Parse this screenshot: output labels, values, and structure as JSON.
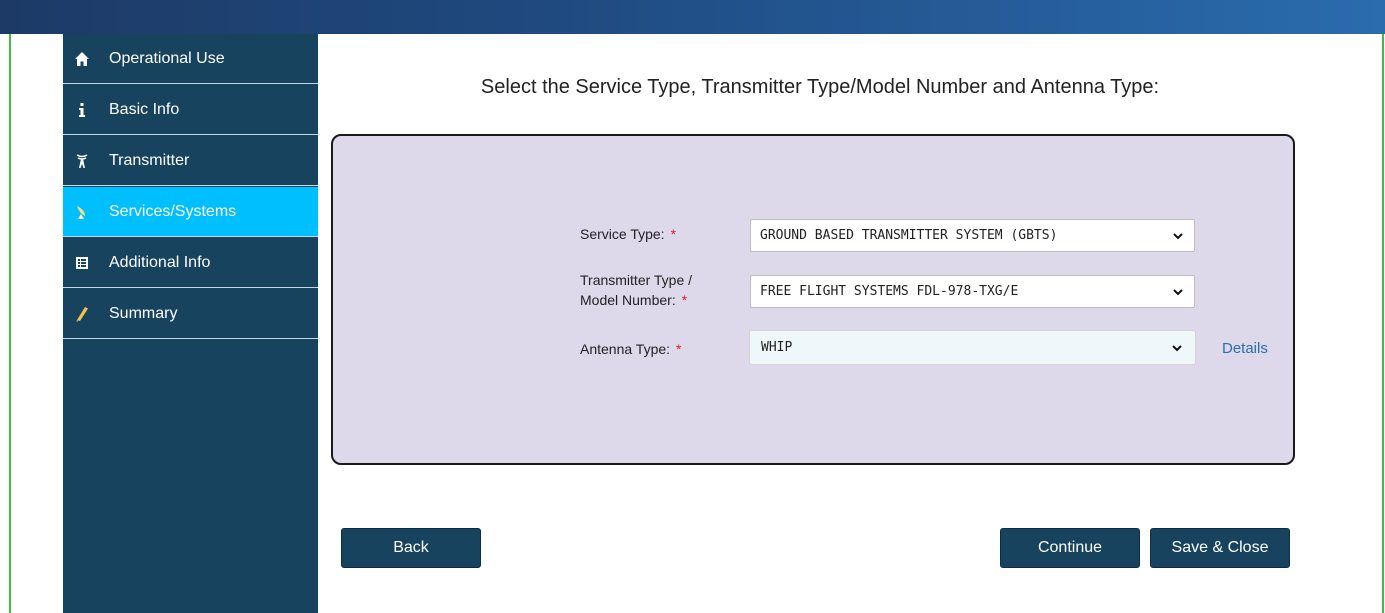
{
  "sidebar": {
    "items": [
      {
        "label": "Operational Use",
        "icon": "home-icon",
        "active": false
      },
      {
        "label": "Basic Info",
        "icon": "info-icon",
        "active": false
      },
      {
        "label": "Transmitter",
        "icon": "transmitter-tower-icon",
        "active": false
      },
      {
        "label": "Services/Systems",
        "icon": "satellite-dish-icon",
        "active": true
      },
      {
        "label": "Additional Info",
        "icon": "list-table-icon",
        "active": false
      },
      {
        "label": "Summary",
        "icon": "pencil-icon",
        "active": false
      }
    ]
  },
  "main": {
    "title": "Select the Service Type, Transmitter Type/Model Number and Antenna Type:",
    "fields": {
      "service_type": {
        "label": "Service Type:",
        "required": "*",
        "value": "GROUND BASED TRANSMITTER SYSTEM (GBTS)"
      },
      "transmitter_type": {
        "label_line1": "Transmitter Type /",
        "label_line2": "Model Number:",
        "required": "*",
        "value": "FREE FLIGHT SYSTEMS FDL-978-TXG/E"
      },
      "antenna_type": {
        "label": "Antenna Type:",
        "required": "*",
        "value": "WHIP",
        "details_link": "Details"
      }
    }
  },
  "buttons": {
    "back": "Back",
    "continue": "Continue",
    "save_close": "Save & Close"
  },
  "colors": {
    "sidebar_bg": "#17435f",
    "active_item": "#00bfff",
    "panel_bg": "#ddd8ea",
    "required": "#e02020",
    "link": "#2c6fa8"
  }
}
